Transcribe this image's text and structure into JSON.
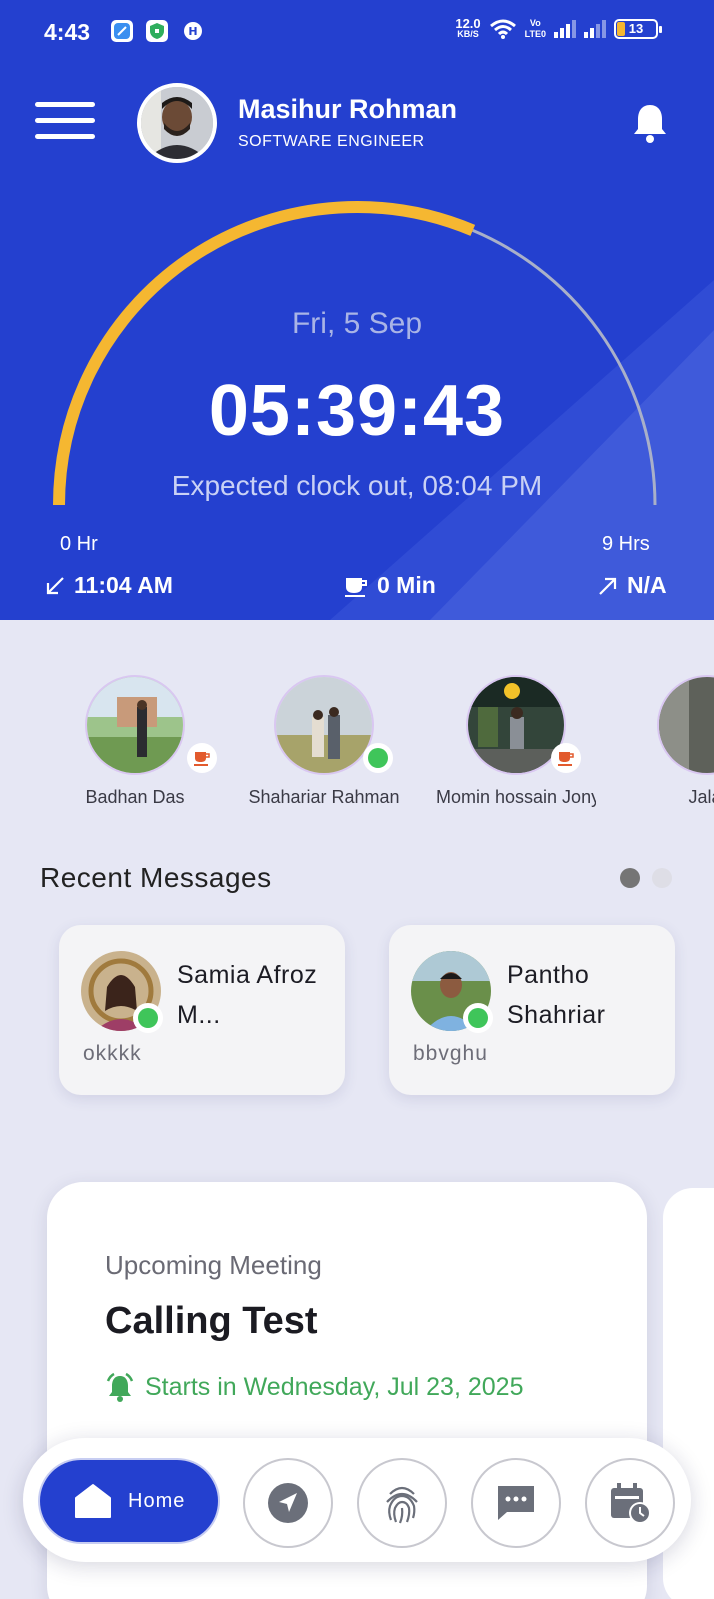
{
  "status_bar": {
    "time": "4:43",
    "speed_value": "12.0",
    "speed_unit": "KB/S",
    "network_label_top": "Vo",
    "network_label_bottom": "LTE0",
    "battery": "13"
  },
  "header": {
    "user_name": "Masihur Rohman",
    "user_role": "SOFTWARE ENGINEER"
  },
  "clock": {
    "date": "Fri, 5 Sep",
    "elapsed": "05:39:43",
    "expected": "Expected clock out, 08:04 PM",
    "min_label": "0 Hr",
    "max_label": "9 Hrs",
    "progress": 0.627,
    "clock_in": "11:04 AM",
    "break": "0 Min",
    "clock_out": "N/A",
    "colors": {
      "progress": "#f5b731",
      "track": "#a9b0c9",
      "background": "#2440cf"
    }
  },
  "team": [
    {
      "name": "Badhan Das",
      "status": "break"
    },
    {
      "name": "Shahariar Rahman",
      "status": "online"
    },
    {
      "name": "Momin hossain Jony",
      "status": "break"
    },
    {
      "name": "Jalal",
      "status": ""
    }
  ],
  "recent_messages": {
    "title": "Recent Messages",
    "items": [
      {
        "name": "Samia Afroz M...",
        "message": "okkkk"
      },
      {
        "name": "Pantho Shahriar",
        "message": "bbvghu"
      }
    ]
  },
  "meeting": {
    "label": "Upcoming Meeting",
    "title": "Calling Test",
    "when": "Starts in Wednesday, Jul 23, 2025"
  },
  "nav": {
    "home_label": "Home",
    "items": [
      "home-icon",
      "location-arrow-icon",
      "fingerprint-icon",
      "chat-icon",
      "calendar-clock-icon"
    ]
  }
}
